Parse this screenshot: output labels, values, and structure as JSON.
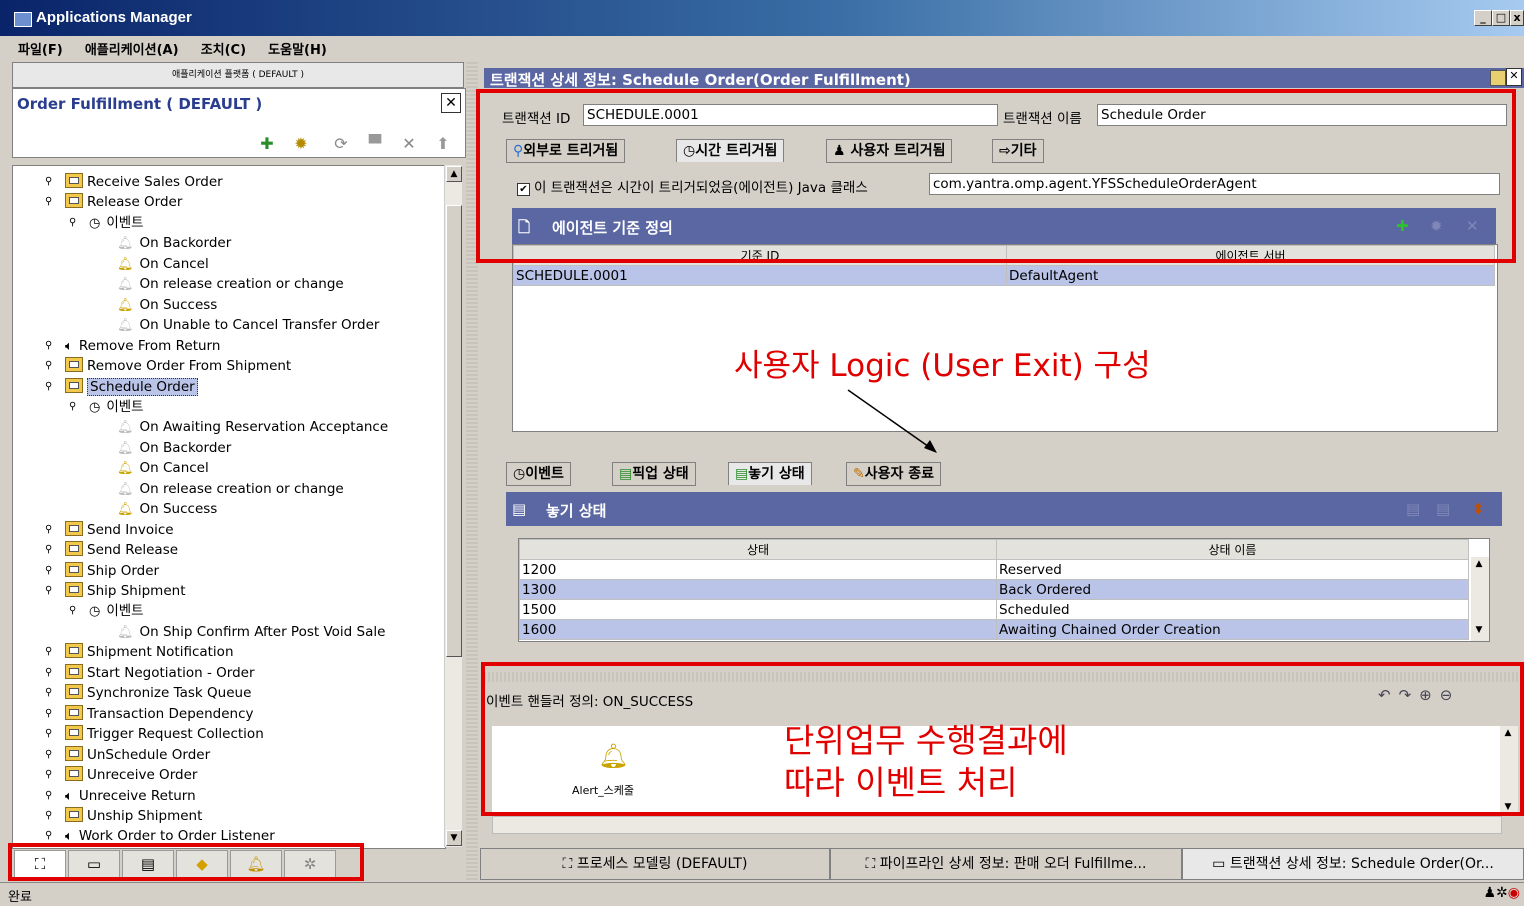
{
  "window": {
    "title": "Applications Manager"
  },
  "menu": [
    "파일(F)",
    "애플리케이션(A)",
    "조치(C)",
    "도움말(H)"
  ],
  "left": {
    "app_combo": "애플리케이션 플랫폼 ( DEFAULT )",
    "title": "Order Fulfillment ( DEFAULT )",
    "toolbar": [
      "add-icon",
      "gear-icon",
      "refresh-icon",
      "save-icon",
      "delete-icon",
      "export-icon"
    ],
    "tree": [
      {
        "label": "Receive Sales Order",
        "indent": 0,
        "icon": "folder"
      },
      {
        "label": "Release Order",
        "indent": 0,
        "icon": "folder"
      },
      {
        "label": "이벤트",
        "indent": 1,
        "icon": "event"
      },
      {
        "label": "On Backorder",
        "indent": 2,
        "icon": "bell-gray"
      },
      {
        "label": "On Cancel",
        "indent": 2,
        "icon": "bell"
      },
      {
        "label": "On release creation or change",
        "indent": 2,
        "icon": "bell-gray"
      },
      {
        "label": "On Success",
        "indent": 2,
        "icon": "bell"
      },
      {
        "label": "On Unable to Cancel Transfer Order",
        "indent": 2,
        "icon": "bell-gray"
      },
      {
        "label": "Remove From Return",
        "indent": 0,
        "icon": "speaker"
      },
      {
        "label": "Remove Order From Shipment",
        "indent": 0,
        "icon": "folder"
      },
      {
        "label": "Schedule Order",
        "indent": 0,
        "icon": "folder",
        "selected": true
      },
      {
        "label": "이벤트",
        "indent": 1,
        "icon": "event"
      },
      {
        "label": "On Awaiting Reservation Acceptance",
        "indent": 2,
        "icon": "bell-gray"
      },
      {
        "label": "On Backorder",
        "indent": 2,
        "icon": "bell-gray"
      },
      {
        "label": "On Cancel",
        "indent": 2,
        "icon": "bell"
      },
      {
        "label": "On release creation or change",
        "indent": 2,
        "icon": "bell-gray"
      },
      {
        "label": "On Success",
        "indent": 2,
        "icon": "bell"
      },
      {
        "label": "Send Invoice",
        "indent": 0,
        "icon": "folder"
      },
      {
        "label": "Send Release",
        "indent": 0,
        "icon": "folder"
      },
      {
        "label": "Ship Order",
        "indent": 0,
        "icon": "folder"
      },
      {
        "label": "Ship Shipment",
        "indent": 0,
        "icon": "folder"
      },
      {
        "label": "이벤트",
        "indent": 1,
        "icon": "event"
      },
      {
        "label": "On Ship Confirm After Post Void Sale",
        "indent": 2,
        "icon": "bell-gray"
      },
      {
        "label": "Shipment Notification",
        "indent": 0,
        "icon": "folder"
      },
      {
        "label": "Start Negotiation - Order",
        "indent": 0,
        "icon": "folder"
      },
      {
        "label": "Synchronize Task Queue",
        "indent": 0,
        "icon": "folder"
      },
      {
        "label": "Transaction Dependency",
        "indent": 0,
        "icon": "folder"
      },
      {
        "label": "Trigger Request Collection",
        "indent": 0,
        "icon": "folder"
      },
      {
        "label": "UnSchedule Order",
        "indent": 0,
        "icon": "folder"
      },
      {
        "label": "Unreceive Order",
        "indent": 0,
        "icon": "folder"
      },
      {
        "label": "Unreceive Return",
        "indent": 0,
        "icon": "speaker"
      },
      {
        "label": "Unship Shipment",
        "indent": 0,
        "icon": "folder"
      },
      {
        "label": "Work Order to Order Listener",
        "indent": 0,
        "icon": "speaker"
      }
    ],
    "bottom_tabs": [
      "pipeline-icon",
      "transaction-icon",
      "document-icon",
      "condition-icon",
      "alert-icon",
      "network-icon"
    ]
  },
  "right": {
    "header": "트랜잭션 상세 정보: Schedule Order(Order Fulfillment)",
    "txn_id_label": "트랜잭션 ID",
    "txn_id_value": "SCHEDULE.0001",
    "txn_name_label": "트랜잭션 이름",
    "txn_name_value": "Schedule Order",
    "tabs": [
      "외부로 트리거됨",
      "시간 트리거됨",
      "사용자 트리거됨",
      "기타"
    ],
    "agent_checkbox": "이 트랜잭션은 시간이 트리거되었음(에이전트) Java 클래스",
    "java_class": "com.yantra.omp.agent.YFSScheduleOrderAgent",
    "agent_criteria_title": "에이전트 기준 정의",
    "agent_cols": [
      "기준 ID",
      "에이전트 서버"
    ],
    "agent_rows": [
      [
        "SCHEDULE.0001",
        "DefaultAgent"
      ]
    ],
    "lower_tabs": [
      "이벤트",
      "픽업 상태",
      "놓기 상태",
      "사용자 종료"
    ],
    "drop_status_title": "놓기 상태",
    "status_cols": [
      "상태",
      "상태 이름"
    ],
    "status_rows": [
      [
        "1200",
        "Reserved"
      ],
      [
        "1300",
        "Back Ordered"
      ],
      [
        "1500",
        "Scheduled"
      ],
      [
        "1600",
        "Awaiting Chained Order Creation"
      ]
    ],
    "event_handler_label": "이벤트 핸들러 정의: ON_SUCCESS",
    "alert_label": "Alert_스케줄"
  },
  "annotations": {
    "user_exit": "사용자 Logic (User Exit) 구성",
    "event_result_line1": "단위업무 수행결과에",
    "event_result_line2": "따라 이벤트 처리"
  },
  "bottom_tabs": [
    "프로세스 모델링 (DEFAULT)",
    "파이프라인 상세 정보: 판매 오더 Fulfillme...",
    "트랜잭션 상세 정보: Schedule Order(Or..."
  ],
  "status": "완료",
  "colors": {
    "annotation_red": "#e00000",
    "header_blue": "#5b67a3",
    "selection": "#b9c4e8"
  }
}
